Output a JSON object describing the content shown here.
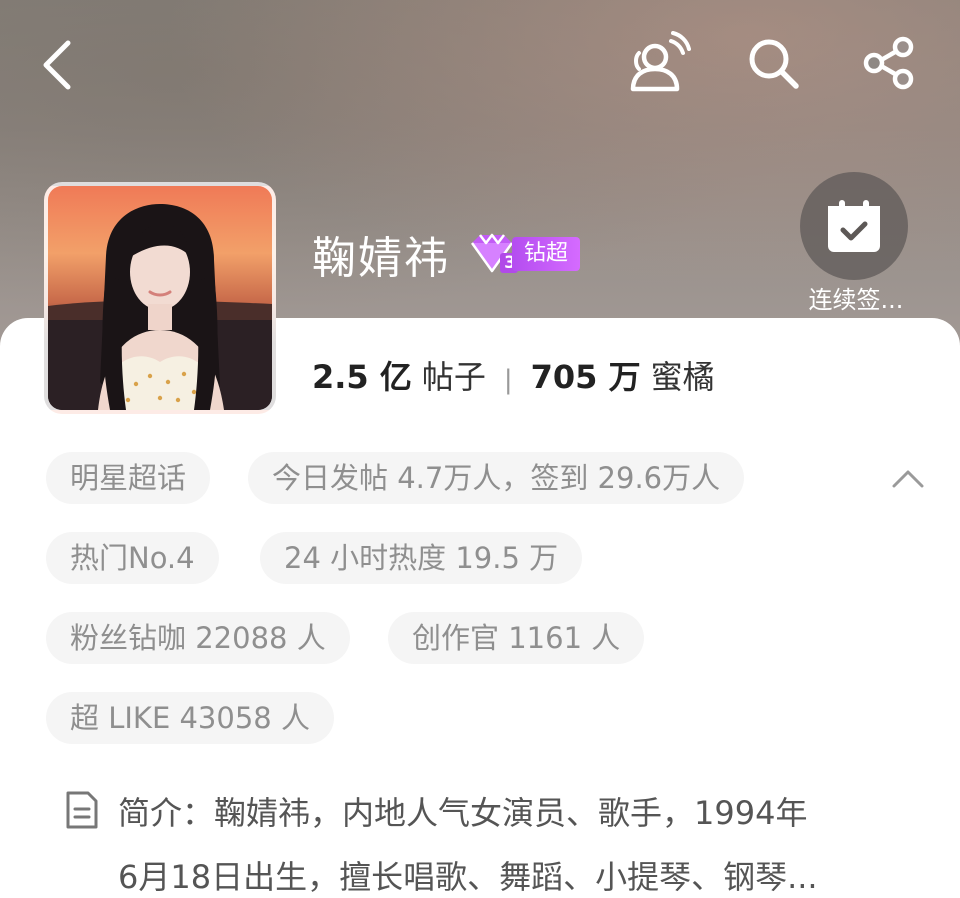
{
  "header": {
    "name": "鞠婧祎",
    "badge_label": "钻超",
    "badge_level": "3",
    "checkin_label": "连续签..."
  },
  "stats": {
    "posts_value": "2.5 亿",
    "posts_label": "帖子",
    "fans_value": "705 万",
    "fans_label": "蜜橘",
    "separator": "|"
  },
  "tags": {
    "category": "明星超话",
    "today": "今日发帖 4.7万人，签到 29.6万人",
    "hot_rank": "热门No.4",
    "heat_24h": "24 小时热度 19.5 万",
    "fans_diamond": "粉丝钻咖 22088 人",
    "creators": "创作官 1161 人",
    "super_like": "超 LIKE 43058 人"
  },
  "intro": {
    "line1": "简介：鞠婧祎，内地人气女演员、歌手，1994年",
    "line2": "6月18日出生，擅长唱歌、舞蹈、小提琴、钢琴..."
  },
  "icons": {
    "back": "chevron-left-icon",
    "topic": "people-broadcast-icon",
    "search": "search-icon",
    "share": "share-icon",
    "checkin": "calendar-check-icon",
    "expand": "chevron-up-icon",
    "intro": "document-icon"
  },
  "colors": {
    "badge_purple": "#c25cf5",
    "chip_bg": "#f5f5f5",
    "chip_text": "#8f8f8f"
  }
}
